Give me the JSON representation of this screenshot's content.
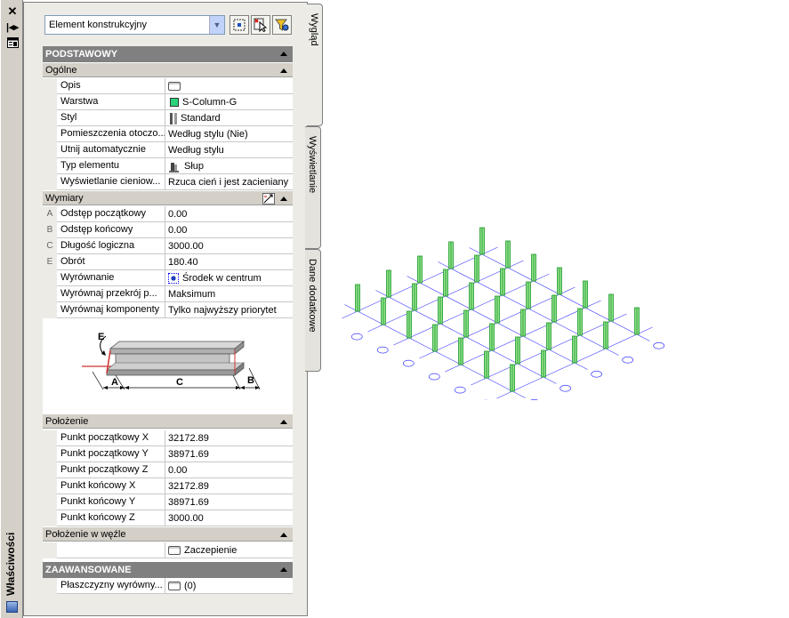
{
  "palette": {
    "title": "Właściwości",
    "close_icon": "close-icon",
    "autohide_icon": "autohide-icon",
    "menu_icon": "properties-menu-icon"
  },
  "toolbar": {
    "selection_type": "Element konstrukcyjny",
    "buttons": [
      "quick-select-icon",
      "select-objects-icon",
      "filter-icon"
    ]
  },
  "tabs": [
    "Wygląd",
    "Wyświetlanie",
    "Dane dodatkowe"
  ],
  "grid": {
    "basic": {
      "label": "PODSTAWOWY",
      "general": {
        "label": "Ogólne",
        "rows": [
          {
            "name": "Opis",
            "value": ""
          },
          {
            "name": "Warstwa",
            "value": "S-Column-G"
          },
          {
            "name": "Styl",
            "value": "Standard"
          },
          {
            "name": "Pomieszczenia otoczo...",
            "value": "Według stylu (Nie)"
          },
          {
            "name": "Utnij automatycznie",
            "value": "Według stylu"
          },
          {
            "name": "Typ elementu",
            "value": "Słup"
          },
          {
            "name": "Wyświetlanie cieniow...",
            "value": "Rzuca cień i jest zacieniany"
          }
        ]
      },
      "dimensions": {
        "label": "Wymiary",
        "rows": [
          {
            "key": "A",
            "name": "Odstęp początkowy",
            "value": "0.00"
          },
          {
            "key": "B",
            "name": "Odstęp końcowy",
            "value": "0.00"
          },
          {
            "key": "C",
            "name": "Długość logiczna",
            "value": "3000.00"
          },
          {
            "key": "E",
            "name": "Obrót",
            "value": "180.40"
          },
          {
            "key": "",
            "name": "Wyrównanie",
            "value": "Środek w centrum"
          },
          {
            "key": "",
            "name": "Wyrównaj przekrój p...",
            "value": "Maksimum"
          },
          {
            "key": "",
            "name": "Wyrównaj komponenty",
            "value": "Tylko najwyższy priorytet"
          }
        ],
        "diagram_labels": [
          "E",
          "A",
          "C",
          "B"
        ]
      },
      "location": {
        "label": "Położenie",
        "rows": [
          {
            "name": "Punkt początkowy X",
            "value": "32172.89"
          },
          {
            "name": "Punkt początkowy Y",
            "value": "38971.69"
          },
          {
            "name": "Punkt początkowy Z",
            "value": "0.00"
          },
          {
            "name": "Punkt końcowy X",
            "value": "32172.89"
          },
          {
            "name": "Punkt końcowy Y",
            "value": "38971.69"
          },
          {
            "name": "Punkt końcowy Z",
            "value": "3000.00"
          }
        ]
      },
      "node_location": {
        "label": "Położenie w węźle",
        "rows": [
          {
            "name": "",
            "value": "Zaczepienie"
          }
        ]
      }
    },
    "advanced": {
      "label": "ZAAWANSOWANE",
      "rows": [
        {
          "name": "Płaszczyzny wyrówny...",
          "value": "(0)"
        }
      ]
    }
  },
  "colors": {
    "layer_swatch": "#2bd47a",
    "grid_lines": "#3a3aff",
    "column": "#1f9a2a"
  }
}
